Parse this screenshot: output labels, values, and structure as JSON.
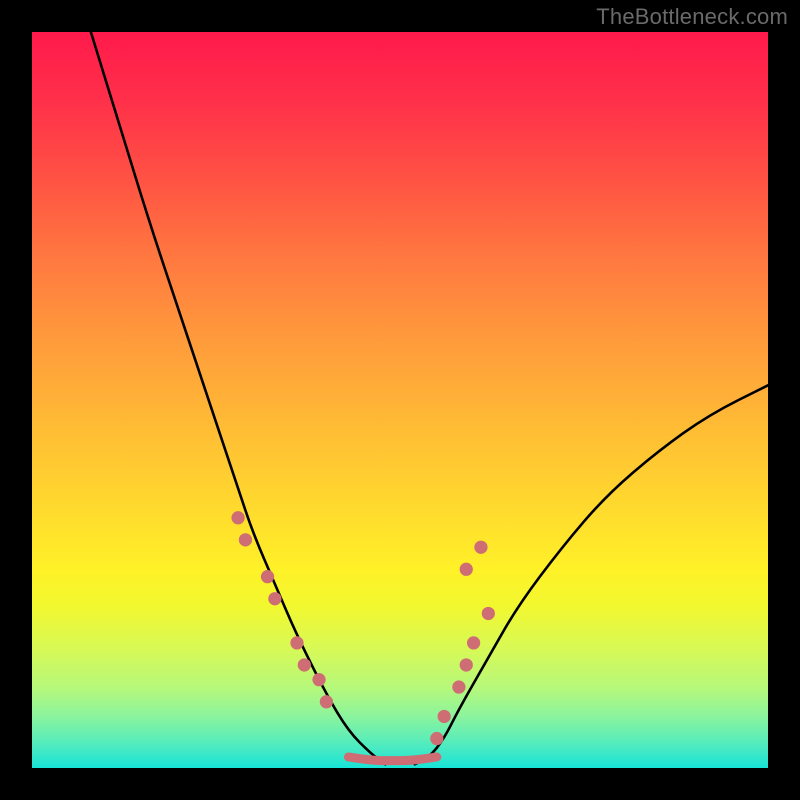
{
  "watermark": "TheBottleneck.com",
  "chart_data": {
    "type": "line",
    "title": "",
    "xlabel": "",
    "ylabel": "",
    "xlim": [
      0,
      100
    ],
    "ylim": [
      0,
      100
    ],
    "grid": false,
    "background_gradient": {
      "stops": [
        {
          "pos": 0,
          "color": "#ff1a4b"
        },
        {
          "pos": 20,
          "color": "#ff5244"
        },
        {
          "pos": 40,
          "color": "#ff983c"
        },
        {
          "pos": 60,
          "color": "#ffd82e"
        },
        {
          "pos": 78,
          "color": "#f2f82f"
        },
        {
          "pos": 90,
          "color": "#8bf49d"
        },
        {
          "pos": 100,
          "color": "#17e3d6"
        }
      ]
    },
    "series": [
      {
        "name": "left-curve",
        "stroke": "#000000",
        "x": [
          8,
          12,
          16,
          20,
          24,
          28,
          30,
          33,
          36,
          40,
          43,
          46,
          48
        ],
        "y": [
          100,
          87,
          74,
          62,
          50,
          38,
          32,
          25,
          18,
          10,
          5,
          2,
          0.5
        ]
      },
      {
        "name": "right-curve",
        "stroke": "#000000",
        "x": [
          52,
          54,
          56,
          58,
          62,
          66,
          72,
          78,
          85,
          92,
          100
        ],
        "y": [
          0.5,
          1.5,
          4,
          8,
          15,
          22,
          30,
          37,
          43,
          48,
          52
        ]
      },
      {
        "name": "flat-bottom",
        "stroke": "#CF6D74",
        "x": [
          43,
          45,
          47,
          49,
          51,
          53,
          55
        ],
        "y": [
          1.5,
          1.2,
          1.0,
          1.0,
          1.0,
          1.2,
          1.5
        ]
      }
    ],
    "markers": [
      {
        "name": "left-dots",
        "color": "#CF6D74",
        "points": [
          [
            28,
            34
          ],
          [
            29,
            31
          ],
          [
            32,
            26
          ],
          [
            33,
            23
          ],
          [
            36,
            17
          ],
          [
            37,
            14
          ],
          [
            39,
            12
          ],
          [
            40,
            9
          ]
        ]
      },
      {
        "name": "right-dots",
        "color": "#CF6D74",
        "points": [
          [
            55,
            4
          ],
          [
            56,
            7
          ],
          [
            58,
            11
          ],
          [
            59,
            14
          ],
          [
            60,
            17
          ],
          [
            62,
            21
          ],
          [
            59,
            27
          ],
          [
            61,
            30
          ]
        ]
      }
    ]
  }
}
